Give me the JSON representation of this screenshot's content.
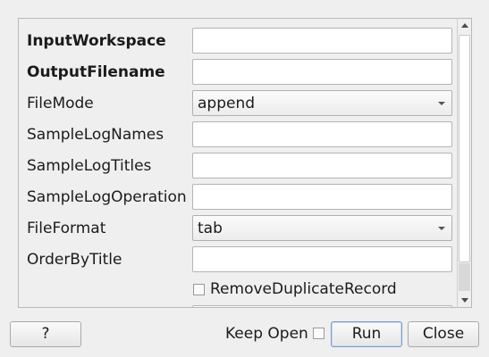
{
  "properties": {
    "input_workspace": {
      "label": "InputWorkspace",
      "value": ""
    },
    "output_filename": {
      "label": "OutputFilename",
      "value": ""
    },
    "file_mode": {
      "label": "FileMode",
      "value": "append"
    },
    "sample_log_names": {
      "label": "SampleLogNames",
      "value": ""
    },
    "sample_log_titles": {
      "label": "SampleLogTitles",
      "value": ""
    },
    "sample_log_operation": {
      "label": "SampleLogOperation",
      "value": ""
    },
    "file_format": {
      "label": "FileFormat",
      "value": "tab"
    },
    "order_by_title": {
      "label": "OrderByTitle",
      "value": ""
    },
    "remove_duplicate_record": {
      "label": "RemoveDuplicateRecord",
      "checked": false
    }
  },
  "footer": {
    "help_label": "?",
    "keep_open_label": "Keep Open",
    "keep_open_checked": false,
    "run_label": "Run",
    "close_label": "Close"
  },
  "icons": {
    "combo_arrow": "chevron-down-icon",
    "scroll_up": "arrow-up-icon",
    "scroll_down": "arrow-down-icon"
  }
}
